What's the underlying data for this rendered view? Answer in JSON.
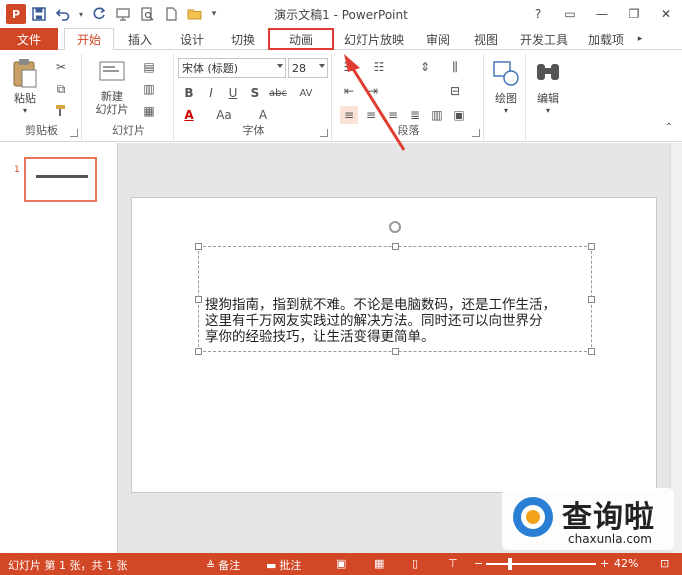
{
  "window": {
    "title": "演示文稿1 - PowerPoint",
    "help": "?",
    "ribbon_options": "▭",
    "minimize": "—",
    "restore": "❐",
    "close": "✕"
  },
  "qat": {
    "logo": "P",
    "save_icon": "save-icon",
    "undo_icon": "undo-icon",
    "redo_icon": "redo-icon"
  },
  "tabs": [
    {
      "label": "文件",
      "type": "file"
    },
    {
      "label": "开始",
      "type": "active"
    },
    {
      "label": "插入"
    },
    {
      "label": "设计"
    },
    {
      "label": "切换"
    },
    {
      "label": "动画",
      "type": "highlight"
    },
    {
      "label": "幻灯片放映"
    },
    {
      "label": "审阅"
    },
    {
      "label": "视图"
    },
    {
      "label": "开发工具"
    },
    {
      "label": "加载项"
    }
  ],
  "ribbon": {
    "clipboard": {
      "label": "剪贴板",
      "paste": "粘贴"
    },
    "slides": {
      "label": "幻灯片",
      "new_slide": "新建\n幻灯片"
    },
    "font": {
      "label": "字体",
      "font_name": "宋体 (标题)",
      "font_size": "28",
      "bold": "B",
      "italic": "I",
      "underline": "U",
      "shadow": "S",
      "strike": "abc",
      "spacing": "AV",
      "font_color": "A",
      "case": "Aa",
      "grow": "A",
      "shrink": "A",
      "clear": "A"
    },
    "paragraph": {
      "label": "段落"
    },
    "drawing": {
      "label": "绘图"
    },
    "editing": {
      "label": "编辑"
    }
  },
  "slide": {
    "number": "1",
    "body_lines": [
      "搜狗指南，指到就不难。不论是电脑数码，还是工作生活，",
      "这里有千万网友实践过的解决方法。同时还可以向世界分",
      "享你的经验技巧，让生活变得更简单。"
    ]
  },
  "status": {
    "slide_info": "幻灯片 第 1 张，共 1 张",
    "notes": "备注",
    "comments": "批注",
    "zoom": "42%"
  },
  "watermark": {
    "brand": "查询啦",
    "url": "chaxunla.com"
  },
  "colors": {
    "accent": "#d24726",
    "highlight_box": "#e03c31"
  }
}
